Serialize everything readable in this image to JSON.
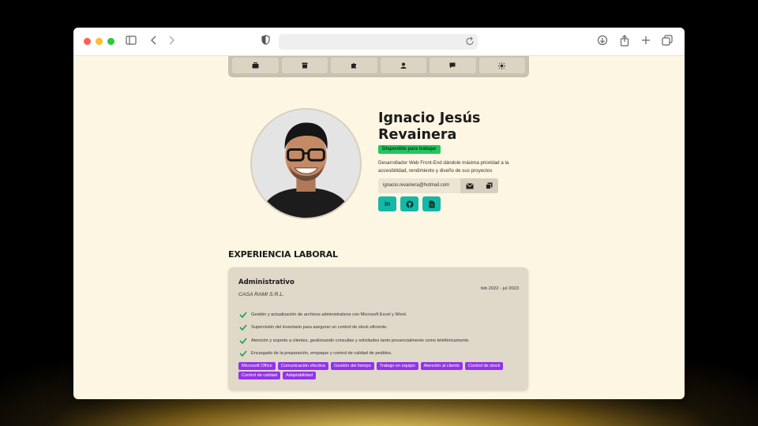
{
  "browser": {
    "address": "",
    "icons": [
      "sidebar-icon",
      "back-icon",
      "forward-icon",
      "shield-icon",
      "reload-icon",
      "download-icon",
      "share-icon",
      "new-tab-icon",
      "tabs-overview-icon"
    ]
  },
  "nav": {
    "items": [
      {
        "icon": "briefcase-icon",
        "glyph": "💼"
      },
      {
        "icon": "box-icon",
        "glyph": "▪"
      },
      {
        "icon": "puzzle-icon",
        "glyph": "♣"
      },
      {
        "icon": "user-icon",
        "glyph": "●"
      },
      {
        "icon": "chat-icon",
        "glyph": "■"
      },
      {
        "icon": "sun-icon",
        "glyph": "✹"
      }
    ]
  },
  "profile": {
    "name": "Ignacio Jesús Revainera",
    "badge": "Disponible para trabajar",
    "description": "Desarrollador Web Front-End dándole máxima prioridad a la accesibilidad, rendimiento y diseño de sus proyectos",
    "email": "ignacio.revainera@hotmail.com",
    "social": [
      {
        "icon": "linkedin-icon",
        "glyph": "in"
      },
      {
        "icon": "github-icon",
        "glyph": "⌾"
      },
      {
        "icon": "document-icon",
        "glyph": "▤"
      }
    ]
  },
  "experience": {
    "section_title": "EXPERIENCIA LABORAL",
    "jobs": [
      {
        "title": "Administrativo",
        "company": "CASA RAMI S.R.L.",
        "dates": "feb 2022 - jul 2023",
        "tasks": [
          "Gestión y actualización de archivos administrativos con Microsoft Excel y Word.",
          "Supervisión del inventario para asegurar un control de stock eficiente.",
          "Atención y soporte a clientes, gestionando consultas y solicitudes tanto presencialmente como telefónicamente.",
          "Encargado de la preparación, empaque y control de calidad de pedidos."
        ],
        "tags": [
          "Microsoft Office",
          "Comunicación efectiva",
          "Gestión del tiempo",
          "Trabajo en equipo",
          "Atención al cliente",
          "Control de stock",
          "Control de calidad",
          "Adaptabilidad"
        ]
      }
    ]
  },
  "colors": {
    "page_bg": "#fdf6e3",
    "badge": "#22c55e",
    "social_btn": "#14b8a6",
    "tag": "#9333ea",
    "card": "#e0d8c8"
  }
}
